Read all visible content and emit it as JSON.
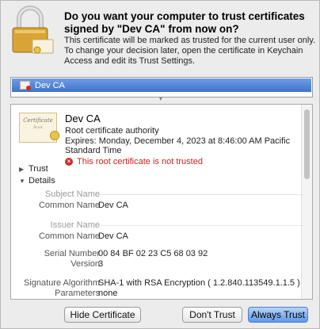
{
  "dialog": {
    "title": "Do you want your computer to trust certificates signed by \"Dev CA\" from now on?",
    "description": "This certificate will be marked as trusted for the current user only. To change your decision later, open the certificate in Keychain Access and edit its Trust Settings."
  },
  "cert_list": {
    "items": [
      {
        "label": "Dev CA",
        "selected": true
      }
    ]
  },
  "certificate": {
    "image_text": "Certificate",
    "image_subtext": "Root",
    "name": "Dev CA",
    "type": "Root certificate authority",
    "expires": "Expires: Monday, December 4, 2023 at 8:46:00 AM Pacific Standard Time",
    "warning": "This root certificate is not trusted",
    "warning_icon": "error-x-icon"
  },
  "sections": {
    "trust": "Trust",
    "details": "Details"
  },
  "details": {
    "subject_name_header": "Subject Name",
    "subject_common_name_label": "Common Name",
    "subject_common_name_value": "Dev CA",
    "issuer_name_header": "Issuer Name",
    "issuer_common_name_label": "Common Name",
    "issuer_common_name_value": "Dev CA",
    "serial_number_label": "Serial Number",
    "serial_number_value": "00 84 BF 02 23 C5 68 03 92",
    "version_label": "Version",
    "version_value": "3",
    "signature_algorithm_label": "Signature Algorithm",
    "signature_algorithm_value": "SHA-1 with RSA Encryption ( 1.2.840.113549.1.1.5 )",
    "parameters_label": "Parameters",
    "parameters_value": "none"
  },
  "buttons": {
    "hide_certificate": "Hide Certificate",
    "dont_trust": "Don't Trust",
    "always_trust": "Always Trust"
  },
  "colors": {
    "selection": "#3f73c9",
    "warning": "#c3271f",
    "default_button": "#5f98ea"
  }
}
